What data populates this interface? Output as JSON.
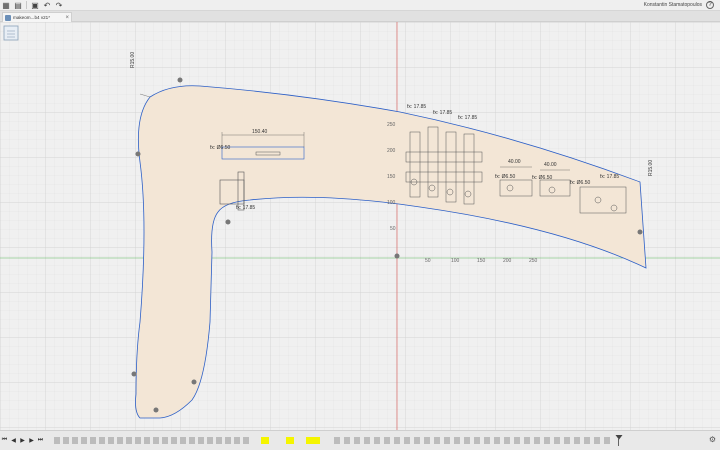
{
  "app": {
    "user_name": "Konstantin Stamatopoulos",
    "toolbar_icons": [
      "grid-icon",
      "file-icon",
      "save-icon",
      "undo-icon",
      "redo-icon"
    ]
  },
  "tab": {
    "label": "makeom...b4 v21*",
    "close": "×"
  },
  "axis_labels": {
    "x": [
      "50",
      "100",
      "150",
      "200",
      "250"
    ],
    "y": [
      "250",
      "200",
      "150",
      "100",
      "50"
    ]
  },
  "dimensions": {
    "r_top_left": "R15.00",
    "r_right": "R15.00",
    "d_150": "150.40",
    "d_fx1": "fx: Ø6.50",
    "d_fx2": "fx: 17.85",
    "d_fx3": "fx: 17.85",
    "d_fx4": "fx: 17.85",
    "d_fx5": "fx: 17.85",
    "d_40a": "40.00",
    "d_40b": "40.00",
    "d_fx6": "fx: Ø6.50",
    "d_fx7": "fx: Ø6.50",
    "d_fx8": "fx: 17.85",
    "d_fx9": "fx: Ø6.50"
  },
  "colors": {
    "profile_fill": "#f3e6d6",
    "profile_stroke": "#2c5fc7",
    "axis_red": "#d9534f",
    "axis_green": "#5cb85c",
    "grid": "#dcdcdc",
    "timeline_marker": "#f5f500"
  },
  "timeline": {
    "controls": [
      "skip-start-icon",
      "step-back-icon",
      "play-icon",
      "step-forward-icon",
      "skip-end-icon"
    ]
  }
}
